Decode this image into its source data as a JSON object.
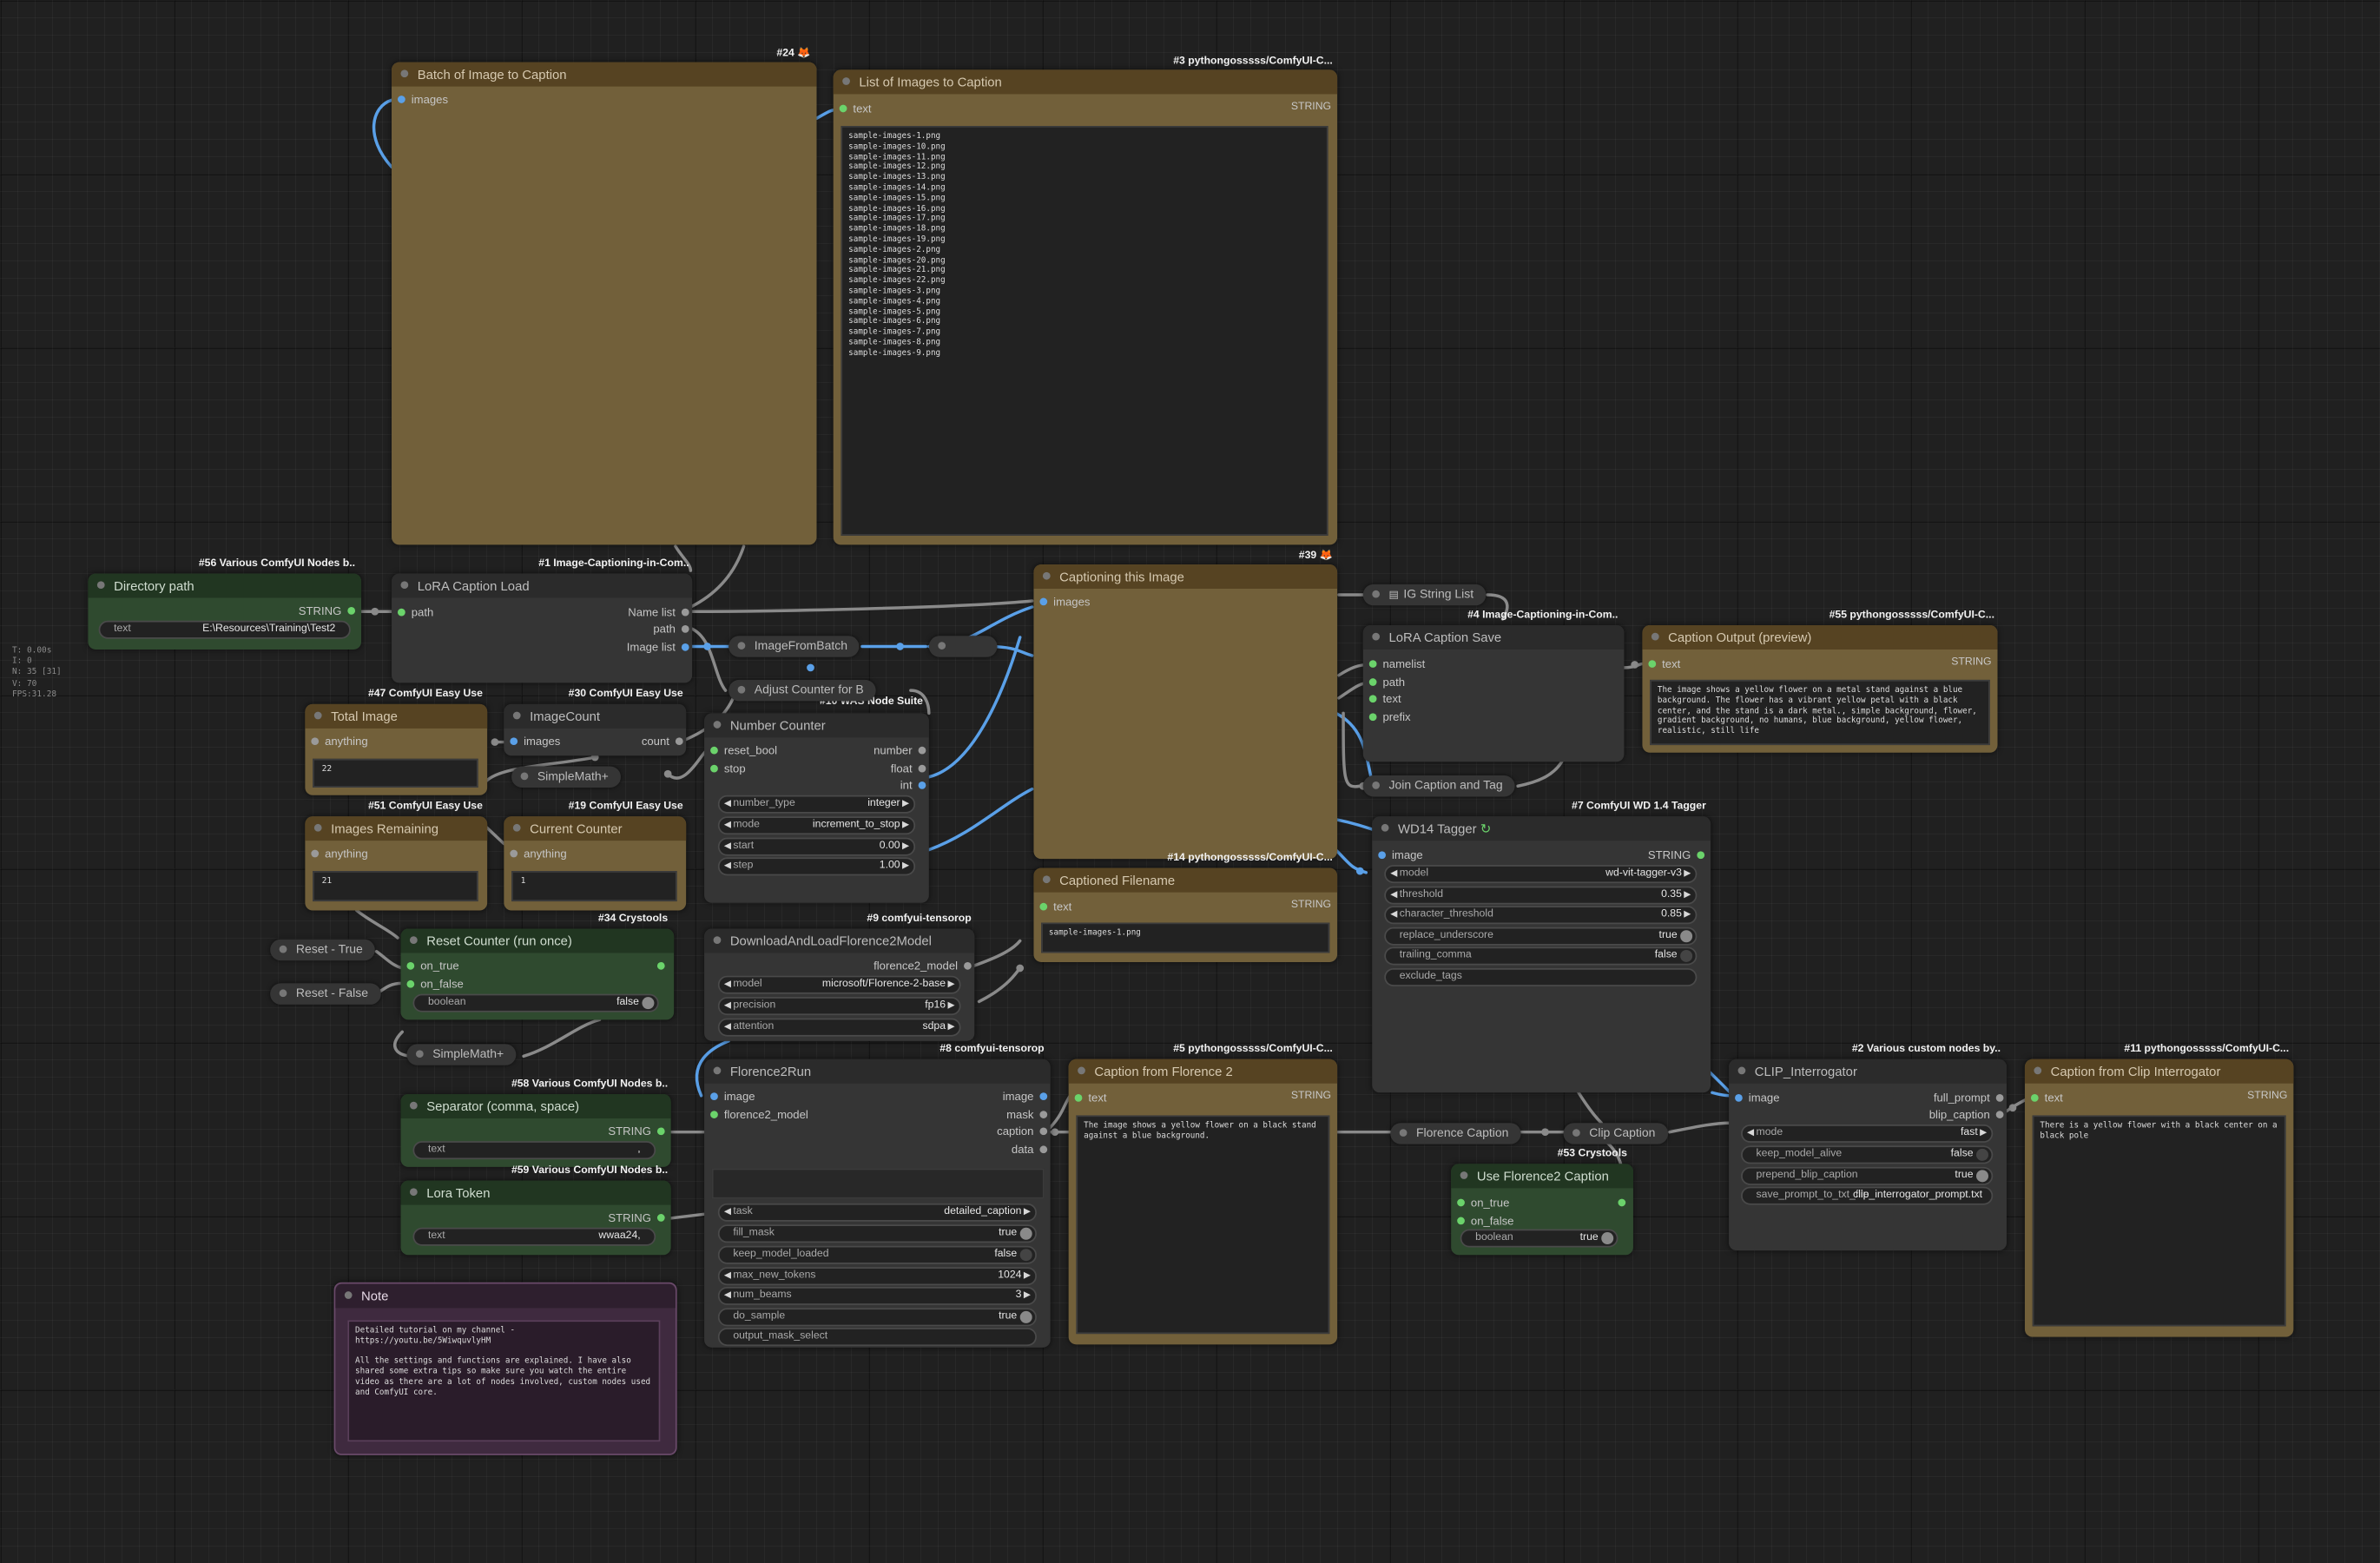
{
  "app": {
    "name": "ComfyUI"
  },
  "stats": {
    "t": "T: 0.00s",
    "i": "I: 0",
    "n": "N: 35 [31]",
    "v": "V: 70",
    "fps": "FPS:31.28"
  },
  "colors": {
    "wire_blue": "#5aa0e8",
    "wire_gray": "#8a8a8a",
    "slot_green": "#6bd36b",
    "node_brown": "#72603a",
    "node_green": "#2f4a2f",
    "node_gray": "#353535",
    "note_purple": "#3f2a3f"
  },
  "nodes": {
    "batch_images": {
      "title": "Batch of Image to Caption",
      "badge": "#24 🦊",
      "input": "images"
    },
    "list_images": {
      "title": "List of Images to Caption",
      "badge": "#3 pythongosssss/ComfyUI-C...",
      "input": "text",
      "type": "STRING",
      "content": "sample-images-1.png\nsample-images-10.png\nsample-images-11.png\nsample-images-12.png\nsample-images-13.png\nsample-images-14.png\nsample-images-15.png\nsample-images-16.png\nsample-images-17.png\nsample-images-18.png\nsample-images-19.png\nsample-images-2.png\nsample-images-20.png\nsample-images-21.png\nsample-images-22.png\nsample-images-3.png\nsample-images-4.png\nsample-images-5.png\nsample-images-6.png\nsample-images-7.png\nsample-images-8.png\nsample-images-9.png"
    },
    "directory_path": {
      "title": "Directory path",
      "badge": "#56 Various ComfyUI Nodes b..",
      "type": "STRING",
      "widget_label": "text",
      "widget_value": "E:\\Resources\\Training\\Test2"
    },
    "lora_caption_load": {
      "title": "LoRA Caption Load",
      "badge": "#1 Image-Captioning-in-Com..",
      "input": "path",
      "outputs": [
        "Name list",
        "path",
        "Image list"
      ]
    },
    "total_image": {
      "title": "Total Image",
      "badge": "#47 ComfyUI Easy Use",
      "input": "anything",
      "value": "22"
    },
    "image_count": {
      "title": "ImageCount",
      "badge": "#30 ComfyUI Easy Use",
      "input": "images",
      "output": "count"
    },
    "simplemath_1": {
      "title": "SimpleMath+"
    },
    "images_remaining": {
      "title": "Images Remaining",
      "badge": "#51 ComfyUI Easy Use",
      "input": "anything",
      "value": "21"
    },
    "current_counter": {
      "title": "Current Counter",
      "badge": "#19 ComfyUI Easy Use",
      "input": "anything",
      "value": "1"
    },
    "image_from_batch": {
      "title": "ImageFromBatch"
    },
    "adjust_counter": {
      "title": "Adjust Counter for B",
      "badge": "#10 WAS Node Suite"
    },
    "number_counter": {
      "title": "Number Counter",
      "inputs": [
        "reset_bool",
        "stop"
      ],
      "outputs": [
        "number",
        "float",
        "int"
      ],
      "widgets": [
        {
          "label": "number_type",
          "value": "integer"
        },
        {
          "label": "mode",
          "value": "increment_to_stop"
        },
        {
          "label": "start",
          "value": "0.00"
        },
        {
          "label": "step",
          "value": "1.00"
        }
      ]
    },
    "reset_true": {
      "title": "Reset - True"
    },
    "reset_false": {
      "title": "Reset - False"
    },
    "reset_counter": {
      "title": "Reset Counter (run once)",
      "badge": "#34 Crystools",
      "inputs": [
        "on_true",
        "on_false"
      ],
      "widget_label": "boolean",
      "widget_value": "false"
    },
    "simplemath_2": {
      "title": "SimpleMath+"
    },
    "download_florence": {
      "title": "DownloadAndLoadFlorence2Model",
      "badge": "#9 comfyui-tensorop",
      "output": "florence2_model",
      "widgets": [
        {
          "label": "model",
          "value": "microsoft/Florence-2-base"
        },
        {
          "label": "precision",
          "value": "fp16"
        },
        {
          "label": "attention",
          "value": "sdpa"
        }
      ]
    },
    "separator": {
      "title": "Separator (comma, space)",
      "badge": "#58 Various ComfyUI Nodes b..",
      "type": "STRING",
      "widget_label": "text",
      "widget_value": ","
    },
    "lora_token": {
      "title": "Lora Token",
      "badge": "#59 Various ComfyUI Nodes b..",
      "type": "STRING",
      "widget_label": "text",
      "widget_value": "wwaa24,"
    },
    "florence2run": {
      "title": "Florence2Run",
      "badge": "#8 comfyui-tensorop",
      "inputs": [
        "image",
        "florence2_model"
      ],
      "outputs": [
        "image",
        "mask",
        "caption",
        "data"
      ],
      "widgets": [
        {
          "label": "task",
          "value": "detailed_caption",
          "kind": "combo"
        },
        {
          "label": "fill_mask",
          "value": "true",
          "kind": "toggle"
        },
        {
          "label": "keep_model_loaded",
          "value": "false",
          "kind": "toggle"
        },
        {
          "label": "max_new_tokens",
          "value": "1024",
          "kind": "combo"
        },
        {
          "label": "num_beams",
          "value": "3",
          "kind": "combo"
        },
        {
          "label": "do_sample",
          "value": "true",
          "kind": "toggle"
        },
        {
          "label": "output_mask_select",
          "value": "",
          "kind": "plain"
        }
      ]
    },
    "note": {
      "title": "Note",
      "content": "Detailed tutorial on my channel - https://youtu.be/5WiwquvlyHM\n\nAll the settings and functions are explained. I have also shared some extra tips so make sure you watch the entire video as there are a lot of nodes involved, custom nodes used and ComfyUI core."
    },
    "captioning_image": {
      "title": "Captioning this Image",
      "badge": "#39 🦊",
      "input": "images"
    },
    "captioned_filename": {
      "title": "Captioned Filename",
      "badge": "#14 pythongosssss/ComfyUI-C...",
      "input": "text",
      "type": "STRING",
      "content": "sample-images-1.png"
    },
    "caption_florence2": {
      "title": "Caption from Florence 2",
      "badge": "#5 pythongosssss/ComfyUI-C...",
      "input": "text",
      "type": "STRING",
      "content": "The image shows a yellow flower on a black stand against a blue background."
    },
    "ig_string_list": {
      "title": "IG String List"
    },
    "lora_caption_save": {
      "title": "LoRA Caption Save",
      "badge": "#4 Image-Captioning-in-Com..",
      "inputs": [
        "namelist",
        "path",
        "text",
        "prefix"
      ]
    },
    "caption_output": {
      "title": "Caption Output (preview)",
      "badge": "#55 pythongosssss/ComfyUI-C...",
      "input": "text",
      "type": "STRING",
      "content": "The image shows a yellow flower on a metal stand against a blue background. The flower has a vibrant yellow petal with a black center, and the stand is a dark metal., simple background, flower, gradient background, no humans, blue background, yellow flower, realistic, still life"
    },
    "join_caption": {
      "title": "Join Caption and Tag"
    },
    "wd14_tagger": {
      "title": "WD14 Tagger",
      "badge": "#7 ComfyUI WD 1.4 Tagger",
      "input": "image",
      "type": "STRING",
      "widgets": [
        {
          "label": "model",
          "value": "wd-vit-tagger-v3",
          "kind": "combo"
        },
        {
          "label": "threshold",
          "value": "0.35",
          "kind": "combo"
        },
        {
          "label": "character_threshold",
          "value": "0.85",
          "kind": "combo"
        },
        {
          "label": "replace_underscore",
          "value": "true",
          "kind": "toggle"
        },
        {
          "label": "trailing_comma",
          "value": "false",
          "kind": "toggle"
        },
        {
          "label": "exclude_tags",
          "value": "",
          "kind": "plain"
        }
      ]
    },
    "florence_caption": {
      "title": "Florence Caption"
    },
    "clip_caption": {
      "title": "Clip Caption"
    },
    "use_florence2": {
      "title": "Use Florence2 Caption",
      "badge": "#53 Crystools",
      "inputs": [
        "on_true",
        "on_false"
      ],
      "widget_label": "boolean",
      "widget_value": "true"
    },
    "clip_interrogator": {
      "title": "CLIP_Interrogator",
      "badge": "#2 Various custom nodes by..",
      "input": "image",
      "outputs": [
        "full_prompt",
        "blip_caption"
      ],
      "widgets": [
        {
          "label": "mode",
          "value": "fast",
          "kind": "combo"
        },
        {
          "label": "keep_model_alive",
          "value": "false",
          "kind": "toggle"
        },
        {
          "label": "prepend_blip_caption",
          "value": "true",
          "kind": "toggle"
        },
        {
          "label": "save_prompt_to_txt_file",
          "value": "clip_interrogator_prompt.txt",
          "kind": "plain"
        }
      ]
    },
    "caption_clip": {
      "title": "Caption from Clip Interrogator",
      "badge": "#11 pythongosssss/ComfyUI-C...",
      "input": "text",
      "type": "STRING",
      "content": "There is a yellow flower with a black center on a black pole"
    }
  }
}
